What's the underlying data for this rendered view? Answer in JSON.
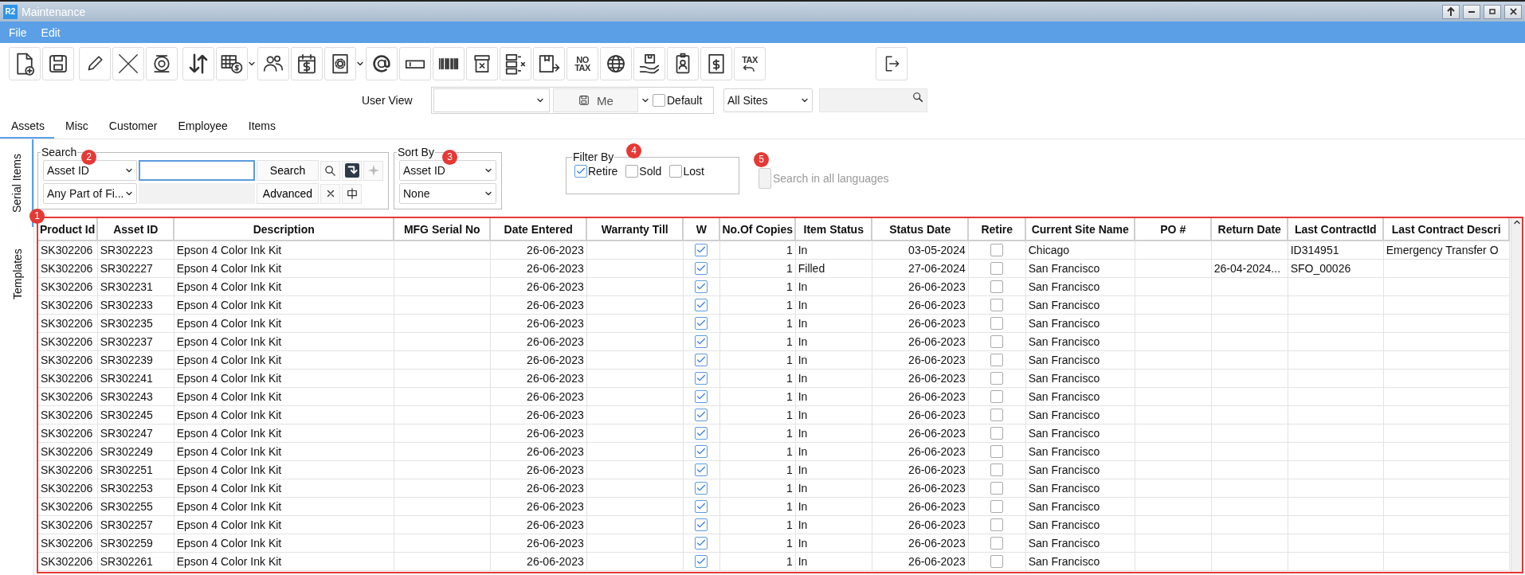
{
  "window": {
    "title": "Maintenance",
    "app_badge": "R2"
  },
  "menu": [
    {
      "label": "File"
    },
    {
      "label": "Edit"
    }
  ],
  "toolbar": {
    "groups": [
      [
        {
          "dropdown": false
        },
        {
          "dropdown": false
        }
      ],
      [
        {
          "dropdown": false
        },
        {
          "dropdown": false
        },
        {
          "dropdown": false
        }
      ],
      [
        {
          "dropdown": false
        },
        {
          "dropdown": true
        },
        {
          "dropdown": false
        },
        {
          "dropdown": false
        },
        {
          "dropdown": true
        },
        {
          "dropdown": false
        },
        {
          "dropdown": false
        },
        {
          "dropdown": false
        },
        {
          "dropdown": false
        },
        {
          "dropdown": false
        },
        {
          "dropdown": false
        },
        {
          "dropdown": false,
          "label": "NO TAX"
        },
        {
          "dropdown": false
        },
        {
          "dropdown": false
        },
        {
          "dropdown": false
        },
        {
          "dropdown": false
        },
        {
          "dropdown": false,
          "label": "TAX"
        }
      ]
    ]
  },
  "user_view": {
    "label": "User View",
    "me_button": "Me",
    "default_checkbox": {
      "label": "Default",
      "checked": false
    },
    "site_select": "All Sites"
  },
  "tabs": [
    {
      "label": "Assets",
      "selected": true
    },
    {
      "label": "Misc",
      "selected": false
    },
    {
      "label": "Customer",
      "selected": false
    },
    {
      "label": "Employee",
      "selected": false
    },
    {
      "label": "Items",
      "selected": false
    }
  ],
  "side_tabs": [
    {
      "label": "Serial Items",
      "selected": true
    },
    {
      "label": "Templates",
      "selected": false
    }
  ],
  "search": {
    "title": "Search",
    "annotation": "2",
    "field_select": "Asset ID",
    "match_select": "Any Part of Fi...",
    "query_focused": true,
    "search_button": "Search",
    "advanced_button": "Advanced"
  },
  "sort": {
    "title": "Sort By",
    "annotation": "3",
    "primary": "Asset ID",
    "secondary": "None"
  },
  "filter": {
    "title": "Filter By",
    "annotation": "4",
    "options": [
      {
        "label": "Retire",
        "checked": true
      },
      {
        "label": "Sold",
        "checked": false
      },
      {
        "label": "Lost",
        "checked": false
      }
    ]
  },
  "languages": {
    "label": "Search in all languages",
    "annotation": "5",
    "checked": false,
    "disabled": true
  },
  "grid": {
    "highlighted": true,
    "annotation": "1",
    "columns": [
      {
        "label": "Product Id",
        "kind": "text"
      },
      {
        "label": "Asset ID",
        "kind": "text"
      },
      {
        "label": "Description",
        "kind": "text"
      },
      {
        "label": "MFG Serial No",
        "kind": "text"
      },
      {
        "label": "Date Entered",
        "kind": "number"
      },
      {
        "label": "Warranty Till",
        "kind": "number"
      },
      {
        "label": "W",
        "kind": "check"
      },
      {
        "label": "No.Of Copies",
        "kind": "number"
      },
      {
        "label": "Item Status",
        "kind": "text"
      },
      {
        "label": "Status Date",
        "kind": "number"
      },
      {
        "label": "Retire",
        "kind": "check"
      },
      {
        "label": "Current Site Name",
        "kind": "text"
      },
      {
        "label": "PO #",
        "kind": "text"
      },
      {
        "label": "Return Date",
        "kind": "text"
      },
      {
        "label": "Last ContractId",
        "kind": "text"
      },
      {
        "label": "Last Contract Descri",
        "kind": "text"
      }
    ],
    "rows": [
      {
        "cells": [
          "SK302206",
          "SR302223",
          "Epson 4 Color Ink Kit",
          null,
          "26-06-2023",
          null,
          true,
          "1",
          "In",
          "03-05-2024",
          false,
          "Chicago",
          null,
          null,
          "ID314951",
          "Emergency Transfer O"
        ]
      },
      {
        "cells": [
          "SK302206",
          "SR302227",
          "Epson 4 Color Ink Kit",
          null,
          "26-06-2023",
          null,
          true,
          "1",
          "Filled",
          "27-06-2024",
          false,
          "San Francisco",
          null,
          "26-04-2024...",
          "SFO_00026",
          null
        ]
      },
      {
        "cells": [
          "SK302206",
          "SR302231",
          "Epson 4 Color Ink Kit",
          null,
          "26-06-2023",
          null,
          true,
          "1",
          "In",
          "26-06-2023",
          false,
          "San Francisco",
          null,
          null,
          null,
          null
        ]
      },
      {
        "cells": [
          "SK302206",
          "SR302233",
          "Epson 4 Color Ink Kit",
          null,
          "26-06-2023",
          null,
          true,
          "1",
          "In",
          "26-06-2023",
          false,
          "San Francisco",
          null,
          null,
          null,
          null
        ]
      },
      {
        "cells": [
          "SK302206",
          "SR302235",
          "Epson 4 Color Ink Kit",
          null,
          "26-06-2023",
          null,
          true,
          "1",
          "In",
          "26-06-2023",
          false,
          "San Francisco",
          null,
          null,
          null,
          null
        ]
      },
      {
        "cells": [
          "SK302206",
          "SR302237",
          "Epson 4 Color Ink Kit",
          null,
          "26-06-2023",
          null,
          true,
          "1",
          "In",
          "26-06-2023",
          false,
          "San Francisco",
          null,
          null,
          null,
          null
        ]
      },
      {
        "cells": [
          "SK302206",
          "SR302239",
          "Epson 4 Color Ink Kit",
          null,
          "26-06-2023",
          null,
          true,
          "1",
          "In",
          "26-06-2023",
          false,
          "San Francisco",
          null,
          null,
          null,
          null
        ]
      },
      {
        "cells": [
          "SK302206",
          "SR302241",
          "Epson 4 Color Ink Kit",
          null,
          "26-06-2023",
          null,
          true,
          "1",
          "In",
          "26-06-2023",
          false,
          "San Francisco",
          null,
          null,
          null,
          null
        ]
      },
      {
        "cells": [
          "SK302206",
          "SR302243",
          "Epson 4 Color Ink Kit",
          null,
          "26-06-2023",
          null,
          true,
          "1",
          "In",
          "26-06-2023",
          false,
          "San Francisco",
          null,
          null,
          null,
          null
        ]
      },
      {
        "cells": [
          "SK302206",
          "SR302245",
          "Epson 4 Color Ink Kit",
          null,
          "26-06-2023",
          null,
          true,
          "1",
          "In",
          "26-06-2023",
          false,
          "San Francisco",
          null,
          null,
          null,
          null
        ]
      },
      {
        "cells": [
          "SK302206",
          "SR302247",
          "Epson 4 Color Ink Kit",
          null,
          "26-06-2023",
          null,
          true,
          "1",
          "In",
          "26-06-2023",
          false,
          "San Francisco",
          null,
          null,
          null,
          null
        ]
      },
      {
        "cells": [
          "SK302206",
          "SR302249",
          "Epson 4 Color Ink Kit",
          null,
          "26-06-2023",
          null,
          true,
          "1",
          "In",
          "26-06-2023",
          false,
          "San Francisco",
          null,
          null,
          null,
          null
        ]
      },
      {
        "cells": [
          "SK302206",
          "SR302251",
          "Epson 4 Color Ink Kit",
          null,
          "26-06-2023",
          null,
          true,
          "1",
          "In",
          "26-06-2023",
          false,
          "San Francisco",
          null,
          null,
          null,
          null
        ]
      },
      {
        "cells": [
          "SK302206",
          "SR302253",
          "Epson 4 Color Ink Kit",
          null,
          "26-06-2023",
          null,
          true,
          "1",
          "In",
          "26-06-2023",
          false,
          "San Francisco",
          null,
          null,
          null,
          null
        ]
      },
      {
        "cells": [
          "SK302206",
          "SR302255",
          "Epson 4 Color Ink Kit",
          null,
          "26-06-2023",
          null,
          true,
          "1",
          "In",
          "26-06-2023",
          false,
          "San Francisco",
          null,
          null,
          null,
          null
        ]
      },
      {
        "cells": [
          "SK302206",
          "SR302257",
          "Epson 4 Color Ink Kit",
          null,
          "26-06-2023",
          null,
          true,
          "1",
          "In",
          "26-06-2023",
          false,
          "San Francisco",
          null,
          null,
          null,
          null
        ]
      },
      {
        "cells": [
          "SK302206",
          "SR302259",
          "Epson 4 Color Ink Kit",
          null,
          "26-06-2023",
          null,
          true,
          "1",
          "In",
          "26-06-2023",
          false,
          "San Francisco",
          null,
          null,
          null,
          null
        ]
      },
      {
        "cells": [
          "SK302206",
          "SR302261",
          "Epson 4 Color Ink Kit",
          null,
          "26-06-2023",
          null,
          true,
          "1",
          "In",
          "26-06-2023",
          false,
          "San Francisco",
          null,
          null,
          null,
          null
        ]
      }
    ]
  }
}
